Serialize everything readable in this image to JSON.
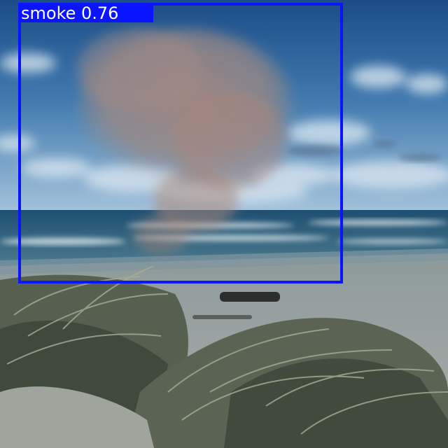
{
  "detection": {
    "class_name": "smoke",
    "confidence": "0.76",
    "box_color": "#0a14ff",
    "label_text_color": "#ffffff"
  },
  "scene": {
    "elements": [
      "sky",
      "clouds",
      "smoke-plume",
      "ocean",
      "breaking-waves",
      "sand-beach",
      "driftwood-log",
      "dune-grass"
    ]
  }
}
